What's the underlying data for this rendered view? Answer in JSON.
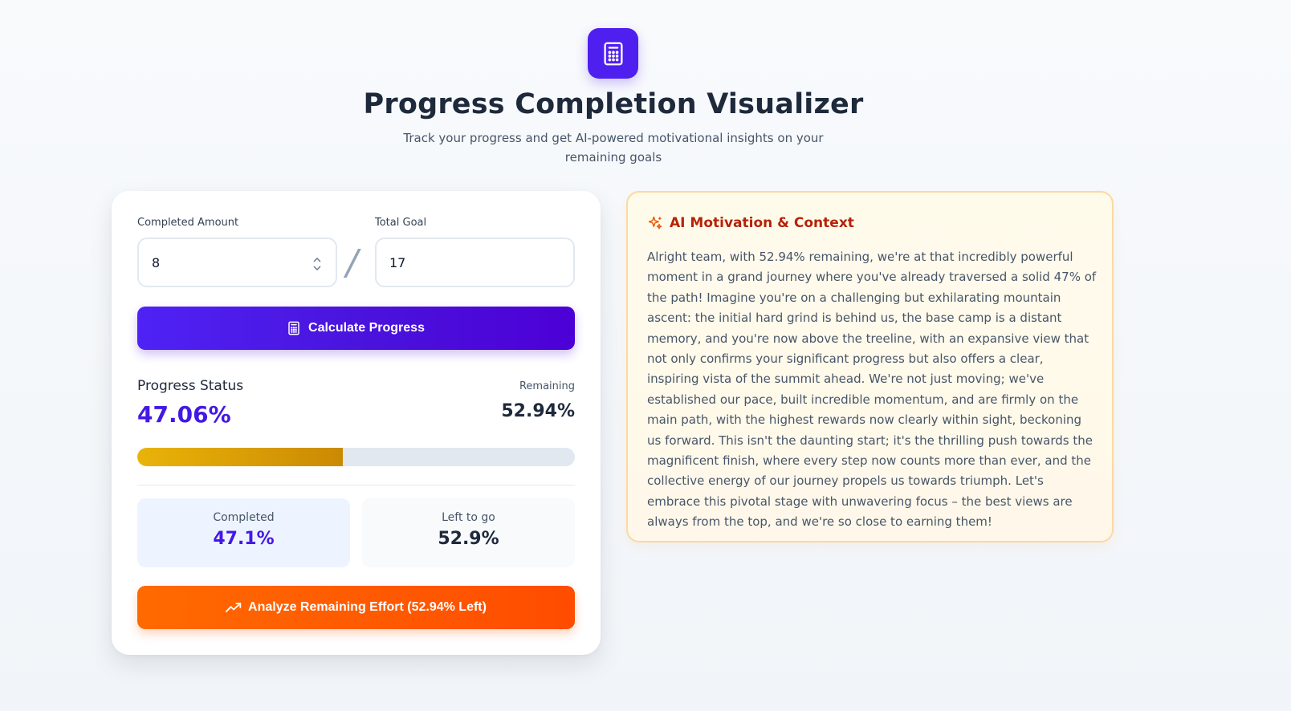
{
  "header": {
    "logo_icon": "calculator-icon",
    "title": "Progress Completion Visualizer",
    "subtitle": "Track your progress and get AI-powered motivational insights on your remaining goals"
  },
  "form": {
    "completed_label": "Completed Amount",
    "completed_value": "8",
    "total_label": "Total Goal",
    "total_value": "17",
    "separator": "/",
    "calculate_label": "Calculate Progress",
    "calculate_icon": "calculator-icon"
  },
  "status": {
    "label": "Progress Status",
    "percent": "47.06%",
    "remaining_label": "Remaining",
    "remaining_value": "52.94%",
    "fill_percent": 47.06
  },
  "stats": {
    "completed_label": "Completed",
    "completed_value": "47.1%",
    "left_label": "Left to go",
    "left_value": "52.9%"
  },
  "analyze": {
    "label": "Analyze Remaining Effort (52.94% Left)",
    "icon": "trending-up-icon"
  },
  "ai": {
    "icon": "sparkles-icon",
    "title": "AI Motivation & Context",
    "text": "Alright team, with 52.94% remaining, we're at that incredibly powerful moment in a grand journey where you've already traversed a solid 47% of the path! Imagine you're on a challenging but exhilarating mountain ascent: the initial hard grind is behind us, the base camp is a distant memory, and you're now above the treeline, with an expansive view that not only confirms your significant progress but also offers a clear, inspiring vista of the summit ahead. We're not just moving; we've established our pace, built incredible momentum, and are firmly on the main path, with the highest rewards now clearly within sight, beckoning us forward. This isn't the daunting start; it's the thrilling push towards the magnificent finish, where every step now counts more than ever, and the collective energy of our journey propels us towards triumph. Let's embrace this pivotal stage with unwavering focus – the best views are always from the top, and we're so close to earning them!"
  },
  "colors": {
    "primary": "#4f1ff0",
    "accent": "#ff5a00",
    "progress": "#eab308",
    "ai_title": "#b42306"
  }
}
